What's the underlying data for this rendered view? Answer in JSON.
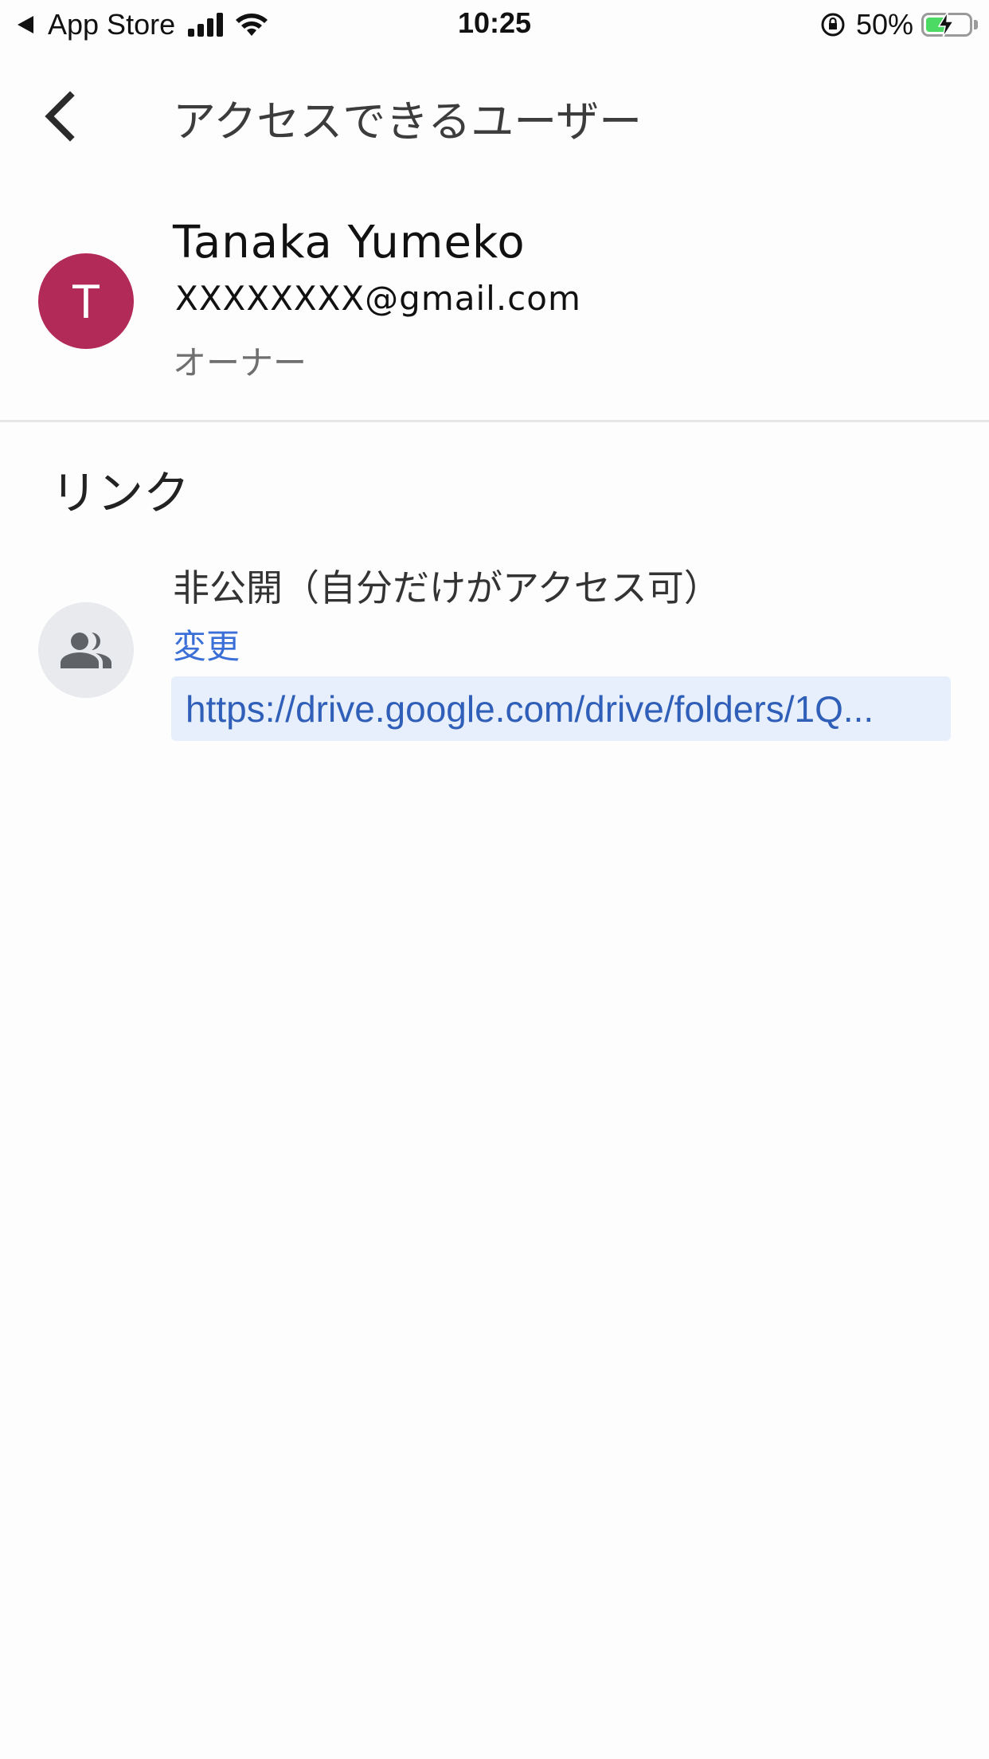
{
  "status_bar": {
    "back_app_label": "App Store",
    "time": "10:25",
    "battery_percent": "50%",
    "battery_level": 0.5,
    "battery_color": "#4cd964"
  },
  "header": {
    "back_icon": "chevron-left-icon",
    "title": "アクセスできるユーザー"
  },
  "owner": {
    "avatar_initial": "T",
    "avatar_color": "#b22a58",
    "name": "Tanaka Yumeko",
    "email": "XXXXXXXX@gmail.com",
    "role": "オーナー"
  },
  "link_section": {
    "title": "リンク",
    "icon": "people-icon",
    "status": "非公開（自分だけがアクセス可）",
    "change_label": "変更",
    "url": "https://drive.google.com/drive/folders/1Q..."
  }
}
